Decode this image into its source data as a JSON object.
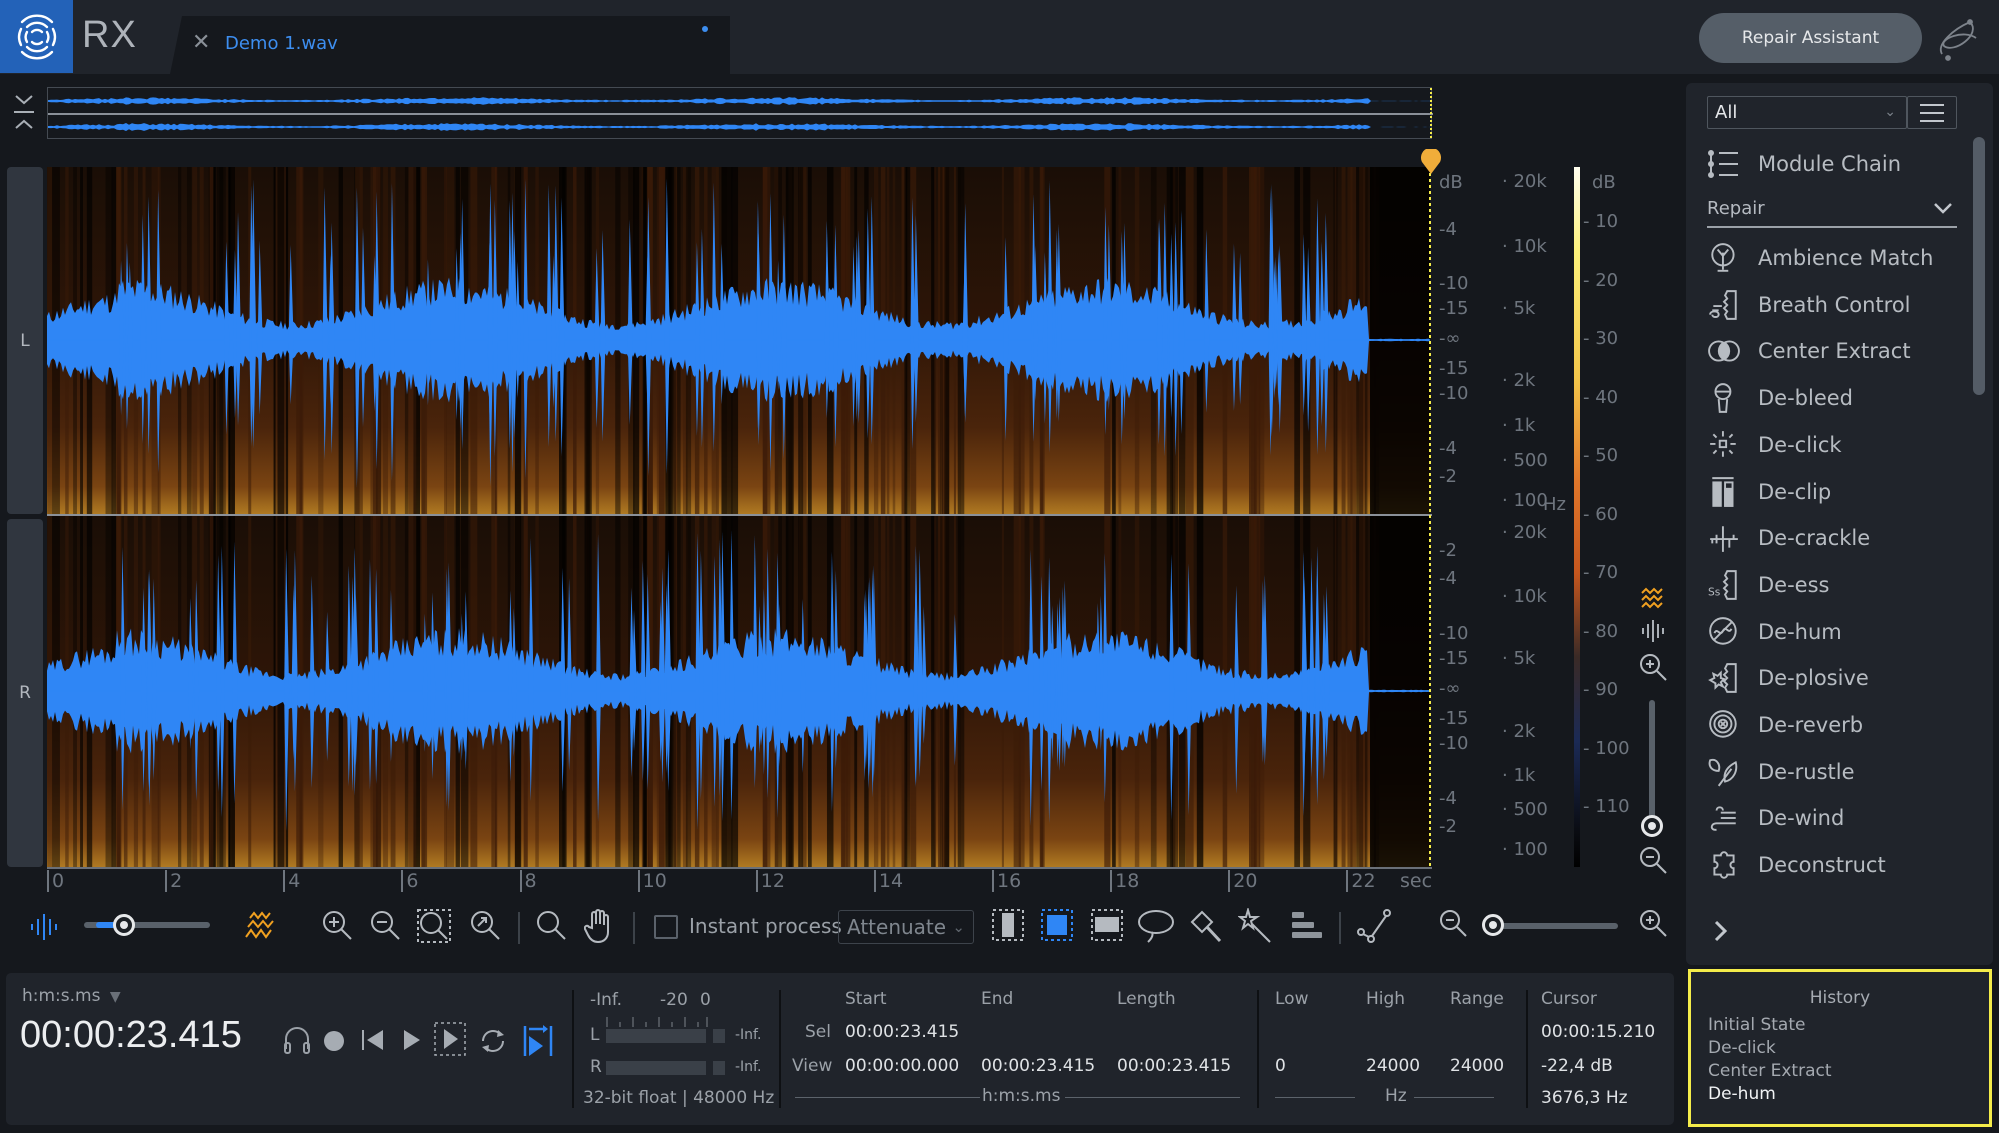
{
  "app": {
    "name": "RX",
    "tab_title": "Demo 1.wav",
    "repair_assistant_label": "Repair Assistant"
  },
  "colors": {
    "accent": "#3d8ef0",
    "waveform": "#2f86f5",
    "cursor_marker": "#f0ad3a",
    "history_highlight": "#f4ec4a",
    "logo_bg": "#2362b8"
  },
  "channels": [
    "L",
    "R"
  ],
  "amplitude_scale": {
    "unit": "dB",
    "L": [
      "-4",
      "-10",
      "-15",
      "-∞",
      "-15",
      "-10",
      "-4",
      "-2"
    ],
    "R": [
      "-2",
      "-4",
      "-10",
      "-15",
      "-∞",
      "-15",
      "-10",
      "-4",
      "-2"
    ]
  },
  "frequency_scale": {
    "unit": "Hz",
    "ticks": [
      "20k",
      "10k",
      "5k",
      "2k",
      "1k",
      "500",
      "100"
    ]
  },
  "color_scale": {
    "unit": "dB",
    "ticks": [
      "10",
      "20",
      "30",
      "40",
      "50",
      "60",
      "70",
      "80",
      "90",
      "100",
      "110"
    ]
  },
  "time_axis": {
    "unit": "sec",
    "ticks": [
      "0",
      "2",
      "4",
      "6",
      "8",
      "10",
      "12",
      "14",
      "16",
      "18",
      "20",
      "22"
    ],
    "max_seconds": 23.415
  },
  "toolbar": {
    "opacity_slider_value": 0.25,
    "instant_process_label": "Instant process",
    "instant_process_checked": false,
    "mode_select_value": "Attenuate",
    "horizontal_zoom_value": 0.0,
    "vertical_zoom_value": 0.0
  },
  "transport": {
    "time_format": "h:m:s.ms",
    "current_time": "00:00:23.415"
  },
  "meter": {
    "scale": [
      "-Inf.",
      "-20",
      "0"
    ],
    "L_label": "L",
    "R_label": "R",
    "L_peak": "-Inf.",
    "R_peak": "-Inf.",
    "format": "32-bit float | 48000 Hz"
  },
  "selection": {
    "headers": [
      "Start",
      "End",
      "Length"
    ],
    "rows": [
      {
        "label": "Sel",
        "start": "00:00:23.415",
        "end": "",
        "length": ""
      },
      {
        "label": "View",
        "start": "00:00:00.000",
        "end": "00:00:23.415",
        "length": "00:00:23.415"
      }
    ],
    "unit": "h:m:s.ms"
  },
  "frequency_range": {
    "headers": [
      "Low",
      "High",
      "Range"
    ],
    "view": {
      "low": "0",
      "high": "24000",
      "range": "24000"
    },
    "unit": "Hz"
  },
  "cursor": {
    "header": "Cursor",
    "time": "00:00:15.210",
    "level": "-22,4 dB",
    "frequency": "3676,3 Hz"
  },
  "module_panel": {
    "filter_value": "All",
    "module_chain_label": "Module Chain",
    "category": "Repair",
    "modules": [
      {
        "label": "Ambience Match",
        "icon": "tree-icon"
      },
      {
        "label": "Breath Control",
        "icon": "breath-face-icon"
      },
      {
        "label": "Center Extract",
        "icon": "overlap-circles-icon"
      },
      {
        "label": "De-bleed",
        "icon": "microphone-icon"
      },
      {
        "label": "De-click",
        "icon": "sparkle-icon"
      },
      {
        "label": "De-clip",
        "icon": "clip-meters-icon"
      },
      {
        "label": "De-crackle",
        "icon": "crackle-icon"
      },
      {
        "label": "De-ess",
        "icon": "ess-face-icon"
      },
      {
        "label": "De-hum",
        "icon": "hum-circle-icon"
      },
      {
        "label": "De-plosive",
        "icon": "plosive-face-icon"
      },
      {
        "label": "De-reverb",
        "icon": "reverb-rings-icon"
      },
      {
        "label": "De-rustle",
        "icon": "leaves-icon"
      },
      {
        "label": "De-wind",
        "icon": "wind-icon"
      },
      {
        "label": "Deconstruct",
        "icon": "puzzle-icon"
      }
    ]
  },
  "history": {
    "title": "History",
    "items": [
      "Initial State",
      "De-click",
      "Center Extract",
      "De-hum"
    ],
    "current_index": 3
  }
}
